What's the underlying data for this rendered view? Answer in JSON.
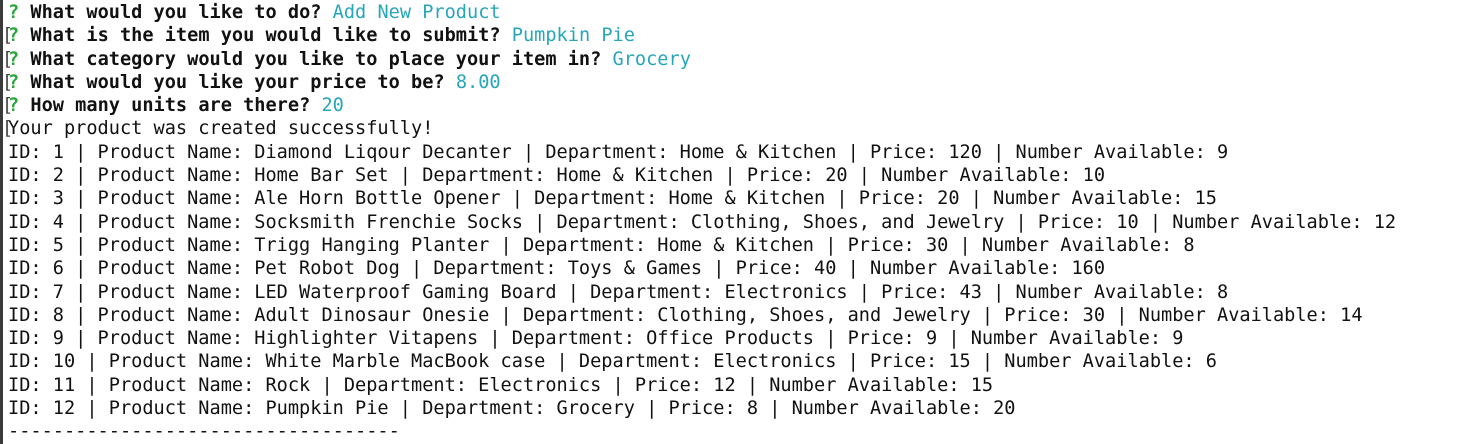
{
  "colors": {
    "question_mark": "#2aa63a",
    "answer": "#27a6b9",
    "text": "#111111",
    "background": "#ffffff"
  },
  "prompts": [
    {
      "mark": "?",
      "question": "What would you like to do?",
      "answer": "Add New Product"
    },
    {
      "mark": "?",
      "question": "What is the item you would like to submit?",
      "answer": "Pumpkin Pie"
    },
    {
      "mark": "?",
      "question": "What category would you like to place your item in?",
      "answer": "Grocery"
    },
    {
      "mark": "?",
      "question": "What would you like your price to be?",
      "answer": "8.00"
    },
    {
      "mark": "?",
      "question": "How many units are there?",
      "answer": "20"
    }
  ],
  "status_message": "Your product was created successfully!",
  "products": [
    "ID: 1 | Product Name: Diamond Liqour Decanter | Department: Home & Kitchen | Price: 120 | Number Available: 9",
    "ID: 2 | Product Name: Home Bar Set | Department: Home & Kitchen | Price: 20 | Number Available: 10",
    "ID: 3 | Product Name: Ale Horn Bottle Opener | Department: Home & Kitchen | Price: 20 | Number Available: 15",
    "ID: 4 | Product Name: Socksmith Frenchie Socks | Department: Clothing, Shoes, and Jewelry | Price: 10 | Number Available: 12",
    "ID: 5 | Product Name: Trigg Hanging Planter | Department: Home & Kitchen | Price: 30 | Number Available: 8",
    "ID: 6 | Product Name: Pet Robot Dog | Department: Toys & Games | Price: 40 | Number Available: 160",
    "ID: 7 | Product Name: LED Waterproof Gaming Board | Department: Electronics | Price: 43 | Number Available: 8",
    "ID: 8 | Product Name: Adult Dinosaur Onesie | Department: Clothing, Shoes, and Jewelry | Price: 30 | Number Available: 14",
    "ID: 9 | Product Name: Highlighter Vitapens | Department: Office Products | Price: 9 | Number Available: 9",
    "ID: 10 | Product Name: White Marble MacBook case | Department: Electronics | Price: 15 | Number Available: 6",
    "ID: 11 | Product Name: Rock | Department: Electronics | Price: 12 | Number Available: 15",
    "ID: 12 | Product Name: Pumpkin Pie | Department: Grocery | Price: 8 | Number Available: 20"
  ],
  "separator": "-----------------------------------"
}
